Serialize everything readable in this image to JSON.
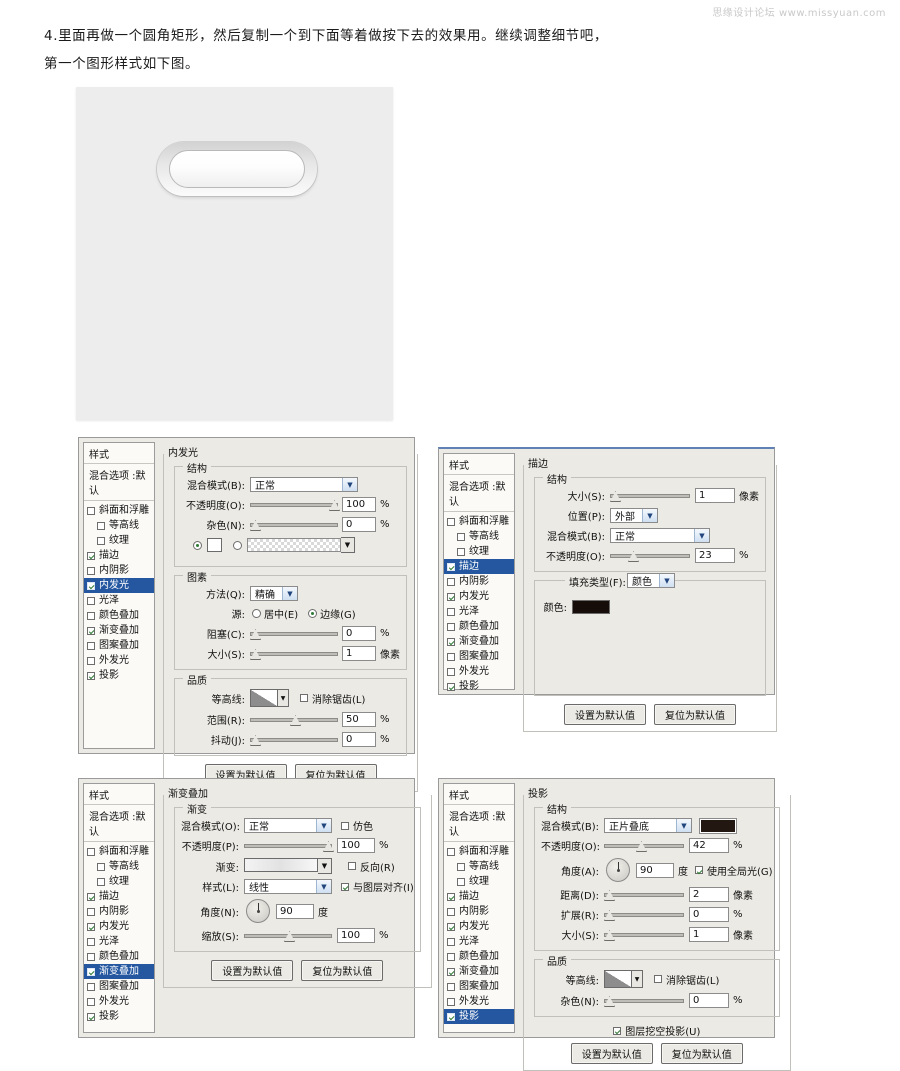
{
  "watermark": "思缘设计论坛  www.missyuan.com",
  "intro": {
    "line1": "4.里面再做一个圆角矩形，然后复制一个到下面等着做按下去的效果用。继续调整细节吧，",
    "line2": "第一个图形样式如下图。"
  },
  "canvas": {
    "name": "rounded-button-artwork"
  },
  "common": {
    "styles_header": "样式",
    "blending_options": "混合选项 :默认",
    "set_default": "设置为默认值",
    "reset_default": "复位为默认值",
    "px": "像素",
    "percent": "%",
    "degree": "度"
  },
  "style_items": [
    {
      "label": "斜面和浮雕",
      "checked": false,
      "indent": false
    },
    {
      "label": "等高线",
      "checked": false,
      "indent": true
    },
    {
      "label": "纹理",
      "checked": false,
      "indent": true
    },
    {
      "label": "描边",
      "checked": true,
      "indent": false
    },
    {
      "label": "内阴影",
      "checked": false,
      "indent": false
    },
    {
      "label": "内发光",
      "checked": true,
      "indent": false
    },
    {
      "label": "光泽",
      "checked": false,
      "indent": false
    },
    {
      "label": "颜色叠加",
      "checked": false,
      "indent": false
    },
    {
      "label": "渐变叠加",
      "checked": true,
      "indent": false
    },
    {
      "label": "图案叠加",
      "checked": false,
      "indent": false
    },
    {
      "label": "外发光",
      "checked": false,
      "indent": false
    },
    {
      "label": "投影",
      "checked": true,
      "indent": false
    }
  ],
  "dialog1": {
    "title": "内发光",
    "selected_style": "内发光",
    "group_structure": "结构",
    "group_elements": "图素",
    "group_quality": "品质",
    "blend_mode_label": "混合模式(B):",
    "blend_mode_value": "正常",
    "opacity_label": "不透明度(O):",
    "opacity_value": "100",
    "noise_label": "杂色(N):",
    "noise_value": "0",
    "method_label": "方法(Q):",
    "method_value": "精确",
    "source_label": "源:",
    "source_center": "居中(E)",
    "source_edge": "边缘(G)",
    "source_selected": "edge",
    "choke_label": "阻塞(C):",
    "choke_value": "0",
    "size_label": "大小(S):",
    "size_value": "1",
    "contour_label": "等高线:",
    "antialias_label": "消除锯齿(L)",
    "antialias_checked": false,
    "range_label": "范围(R):",
    "range_value": "50",
    "jitter_label": "抖动(J):",
    "jitter_value": "0"
  },
  "dialog2": {
    "title": "描边",
    "selected_style": "描边",
    "group_structure": "结构",
    "size_label": "大小(S):",
    "size_value": "1",
    "position_label": "位置(P):",
    "position_value": "外部",
    "blend_mode_label": "混合模式(B):",
    "blend_mode_value": "正常",
    "opacity_label": "不透明度(O):",
    "opacity_value": "23",
    "fill_type_label": "填充类型(F):",
    "fill_type_value": "颜色",
    "color_label": "颜色:",
    "color_value": "#160d0a"
  },
  "dialog3": {
    "title": "渐变叠加",
    "selected_style": "渐变叠加",
    "group_gradient": "渐变",
    "blend_mode_label": "混合模式(O):",
    "blend_mode_value": "正常",
    "dither_label": "仿色",
    "dither_checked": false,
    "opacity_label": "不透明度(P):",
    "opacity_value": "100",
    "gradient_label": "渐变:",
    "reverse_label": "反向(R)",
    "reverse_checked": false,
    "style_label": "样式(L):",
    "style_value": "线性",
    "align_label": "与图层对齐(I)",
    "align_checked": true,
    "angle_label": "角度(N):",
    "angle_value": "90",
    "scale_label": "缩放(S):",
    "scale_value": "100"
  },
  "dialog4": {
    "title": "投影",
    "selected_style": "投影",
    "group_structure": "结构",
    "group_quality": "品质",
    "blend_mode_label": "混合模式(B):",
    "blend_mode_value": "正片叠底",
    "shadow_color": "#231712",
    "opacity_label": "不透明度(O):",
    "opacity_value": "42",
    "angle_label": "角度(A):",
    "angle_value": "90",
    "global_light_label": "使用全局光(G)",
    "global_light_checked": true,
    "distance_label": "距离(D):",
    "distance_value": "2",
    "spread_label": "扩展(R):",
    "spread_value": "0",
    "size_label": "大小(S):",
    "size_value": "1",
    "contour_label": "等高线:",
    "antialias_label": "消除锯齿(L)",
    "antialias_checked": false,
    "noise_label": "杂色(N):",
    "noise_value": "0",
    "knockout_label": "图层挖空投影(U)",
    "knockout_checked": true
  }
}
